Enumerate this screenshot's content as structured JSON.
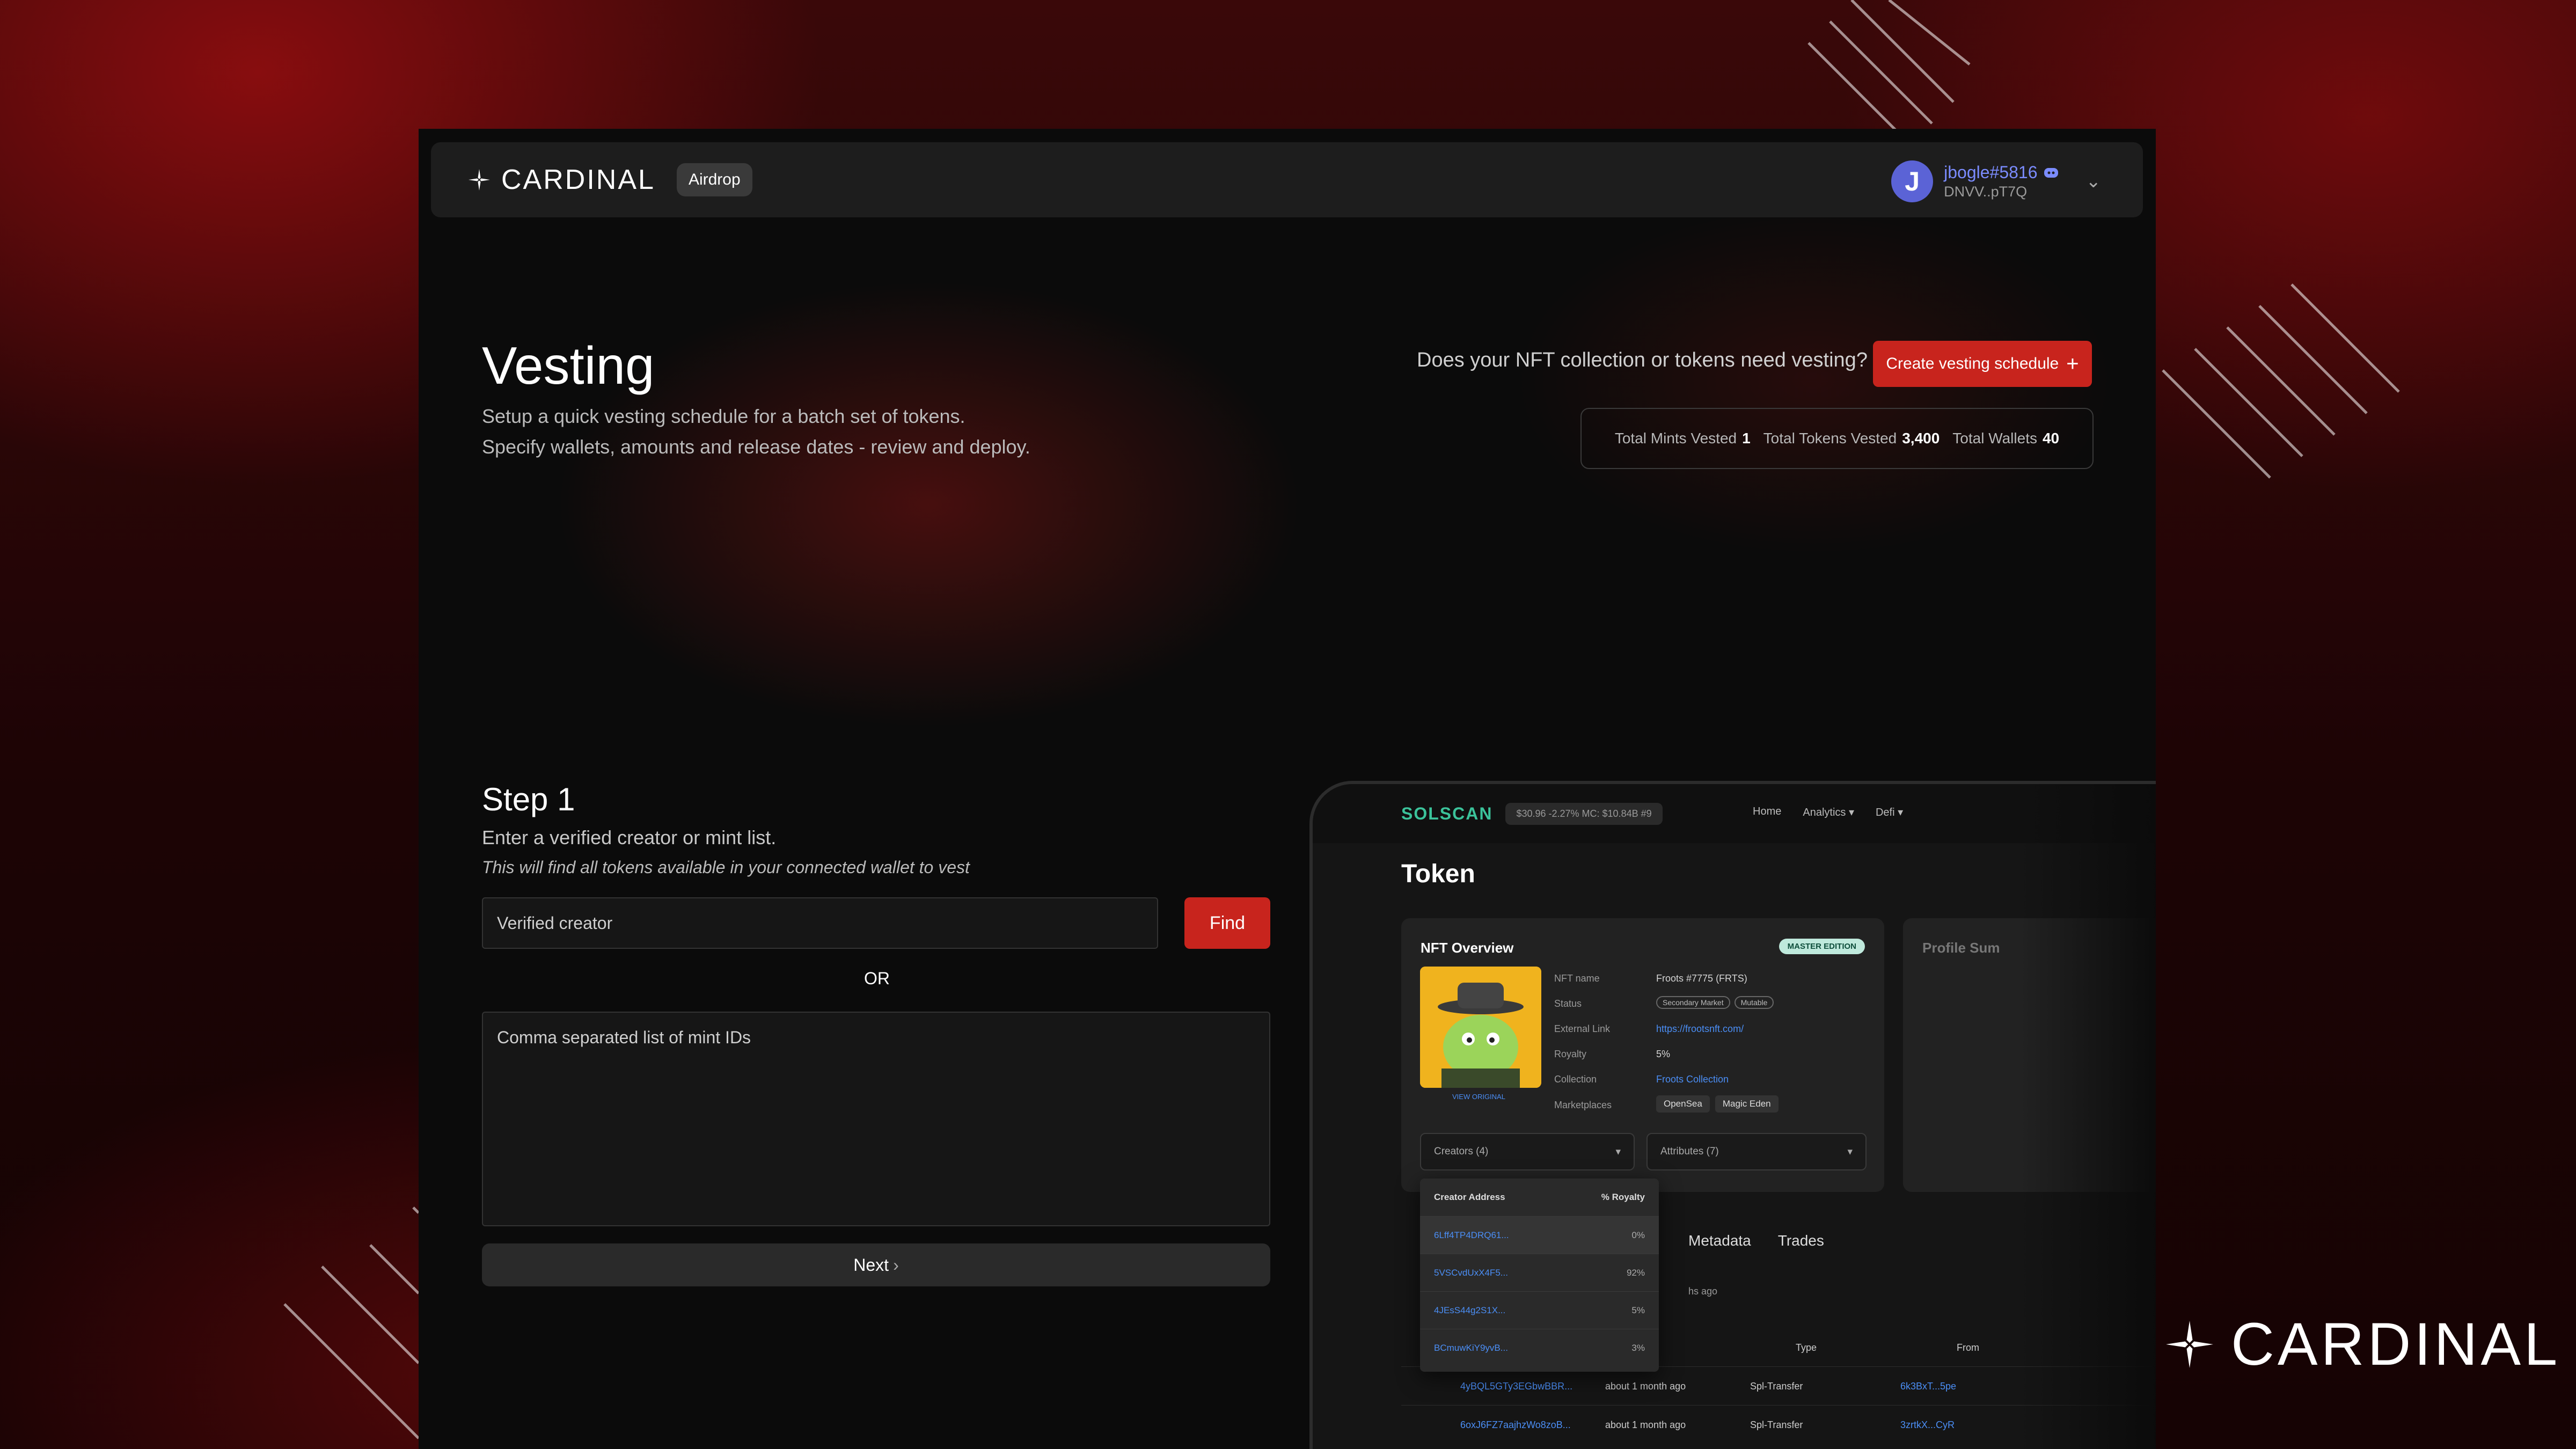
{
  "brand": {
    "name": "CARDINAL"
  },
  "nav": {
    "badge": "Airdrop",
    "user_name": "jbogle#5816",
    "user_address": "DNVV..pT7Q",
    "avatar_letter": "J"
  },
  "page": {
    "title": "Vesting",
    "subtitle_1": "Setup a quick vesting schedule for a batch set of tokens.",
    "subtitle_2": "Specify wallets, amounts and release dates - review and deploy.",
    "prompt": "Does your NFT collection or tokens need vesting?",
    "create_button": "Create vesting schedule"
  },
  "stats": {
    "mints_label": "Total Mints Vested",
    "mints_value": "1",
    "tokens_label": "Total Tokens Vested",
    "tokens_value": "3,400",
    "wallets_label": "Total Wallets",
    "wallets_value": "40"
  },
  "step": {
    "title": "Step 1",
    "desc": "Enter a verified creator or mint list.",
    "note": "This will find all tokens available in your connected wallet to vest",
    "creator_placeholder": "Verified creator",
    "find_button": "Find",
    "or": "OR",
    "mint_placeholder": "Comma separated list of mint IDs",
    "next_button": "Next"
  },
  "preview": {
    "site": "SOLSCAN",
    "price_chip": "$30.96  -2.27%    MC: $10.84B  #9",
    "links": [
      "Home",
      "Analytics ▾",
      "Defi ▾"
    ],
    "page_title": "Token",
    "card_title": "NFT Overview",
    "edition": "MASTER EDITION",
    "view_original": "VIEW ORIGINAL",
    "fields": [
      {
        "label": "NFT name",
        "value": "Froots #7775 (FRTS)"
      },
      {
        "label": "Status",
        "value": ""
      },
      {
        "label": "External Link",
        "value": "https://frootsnft.com/"
      },
      {
        "label": "Royalty",
        "value": "5%"
      },
      {
        "label": "Collection",
        "value": "Froots Collection"
      },
      {
        "label": "Marketplaces",
        "value": ""
      }
    ],
    "status_tags": [
      "Secondary Market",
      "Mutable"
    ],
    "markets": [
      "OpenSea",
      "Magic Eden"
    ],
    "creators_select": "Creators (4)",
    "attributes_select": "Attributes (7)",
    "profile_title": "Profile Sum",
    "dropdown_header_addr": "Creator Address",
    "dropdown_header_royalty": "% Royalty",
    "creators": [
      {
        "address": "6Lff4TP4DRQ61...",
        "royalty": "0%"
      },
      {
        "address": "5VSCvdUxX4F5...",
        "royalty": "92%"
      },
      {
        "address": "4JEsS44g2S1X...",
        "royalty": "5%"
      },
      {
        "address": "BCmuwKiY9yvB...",
        "royalty": "3%"
      }
    ],
    "tabs": [
      "Metadata",
      "Trades"
    ],
    "time_ago": "hs ago",
    "table_head": {
      "type": "Type",
      "from": "From"
    },
    "rows": [
      {
        "sig": "4yBQL5GTy3EGbwBBR...",
        "time": "about 1 month ago",
        "type": "Spl-Transfer",
        "from": "6k3BxT...5pe"
      },
      {
        "sig": "6oxJ6FZ7aajhzWo8zoB...",
        "time": "about 1 month ago",
        "type": "Spl-Transfer",
        "from": "3zrtkX...CyR"
      }
    ]
  }
}
